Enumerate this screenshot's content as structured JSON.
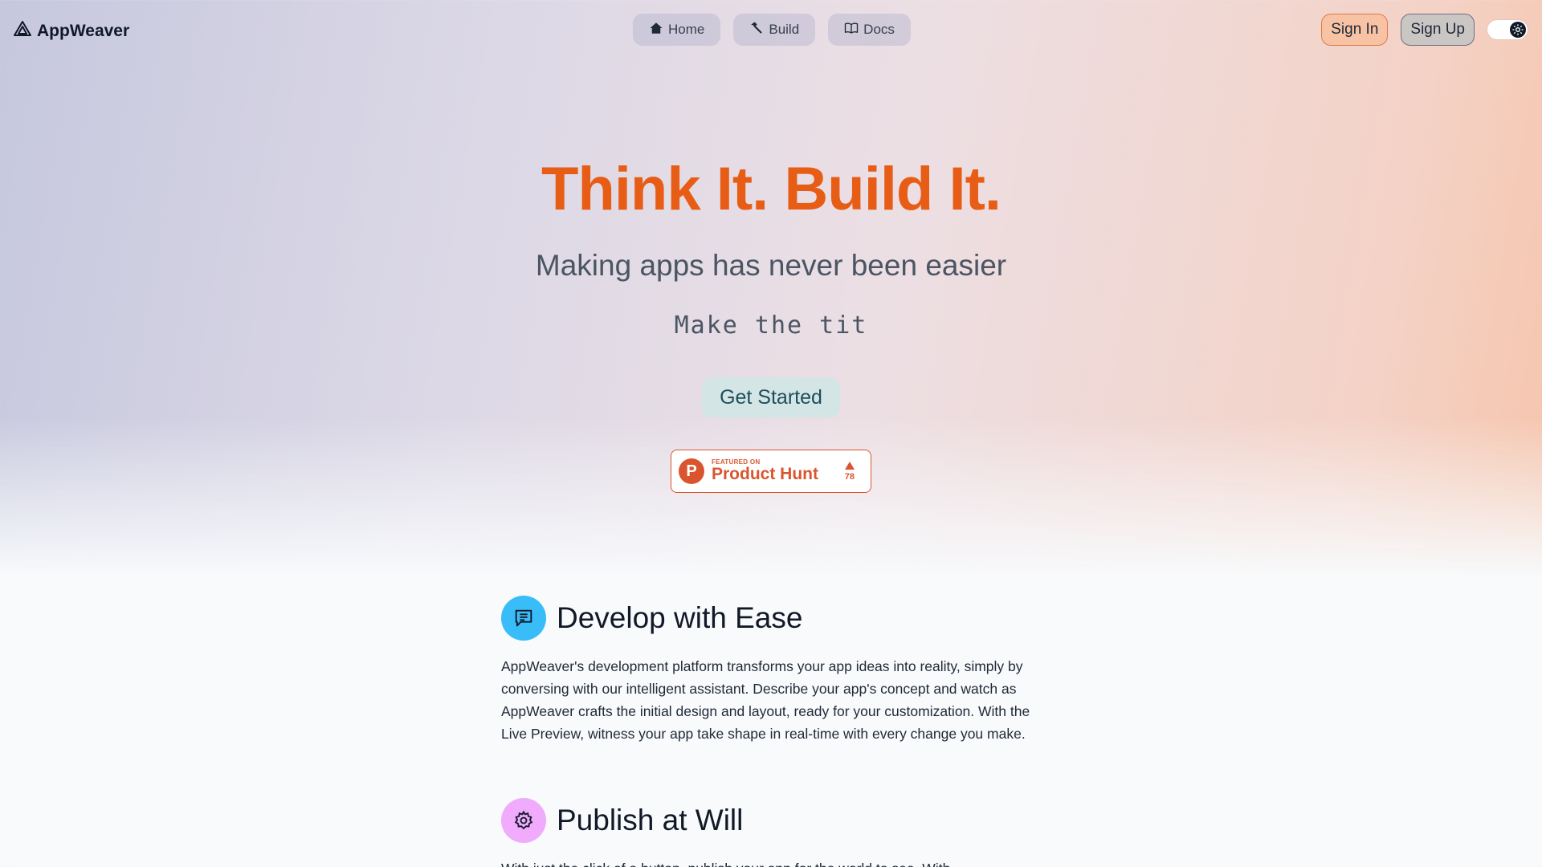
{
  "brand": {
    "name": "AppWeaver",
    "logo_icon": "triangle-logo-icon"
  },
  "nav": [
    {
      "label": "Home",
      "icon": "home-icon"
    },
    {
      "label": "Build",
      "icon": "hammer-icon"
    },
    {
      "label": "Docs",
      "icon": "book-open-icon"
    }
  ],
  "auth": {
    "sign_in": "Sign In",
    "sign_up": "Sign Up",
    "theme_toggle_icon": "gear-icon"
  },
  "hero": {
    "title": "Think It. Build It.",
    "subtitle": "Making apps has never been easier",
    "typing_text": "Make the tit",
    "cta_label": "Get Started",
    "title_color": "#e85d15"
  },
  "product_hunt": {
    "featured_on": "FEATURED ON",
    "name": "Product Hunt",
    "logo_letter": "P",
    "votes": "78",
    "color": "#da552f"
  },
  "features": [
    {
      "title": "Develop with Ease",
      "icon": "chat-message-icon",
      "icon_color": "#38bdf8",
      "body": "AppWeaver's development platform transforms your app ideas into reality, simply by conversing with our intelligent assistant. Describe your app's concept and watch as AppWeaver crafts the initial design and layout, ready for your customization. With the Live Preview, witness your app take shape in real-time with every change you make."
    },
    {
      "title": "Publish at Will",
      "icon": "gear-icon",
      "icon_color": "#f0abfc",
      "body": "With just the click of a button, publish your app for the world to see. With"
    }
  ]
}
